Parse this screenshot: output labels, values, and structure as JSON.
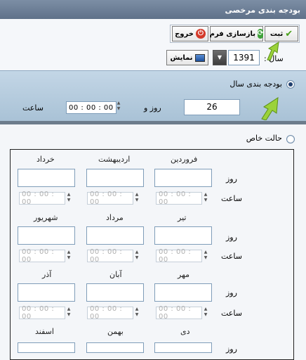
{
  "window": {
    "title": "بودجه بندی مرخصی"
  },
  "toolbar": {
    "save_label": "ثبت",
    "reset_label": "بازسازی فرم",
    "exit_label": "خروج"
  },
  "year": {
    "label": "سال :",
    "value": "1391",
    "show_label": "نمایش"
  },
  "annual": {
    "label": "بودجه بندی سال",
    "days_value": "26",
    "day_and_label": "روز و",
    "time_value": "00 : 00 : 00",
    "hour_label": "ساعت",
    "selected": true
  },
  "special": {
    "label": "حالت خاص",
    "selected": false
  },
  "grid": {
    "day_label": "روز",
    "hour_label": "ساعت",
    "time_placeholder": "00 : 00 : 00",
    "rows": [
      [
        "فروردین",
        "اردیبهشت",
        "خرداد"
      ],
      [
        "تیر",
        "مرداد",
        "شهریور"
      ],
      [
        "مهر",
        "آبان",
        "آذر"
      ],
      [
        "دی",
        "بهمن",
        "اسفند"
      ]
    ]
  },
  "colors": {
    "titlebar": "#6b7d95",
    "section_bg": "#b6cbdc",
    "accent_green": "#5ea61c"
  }
}
